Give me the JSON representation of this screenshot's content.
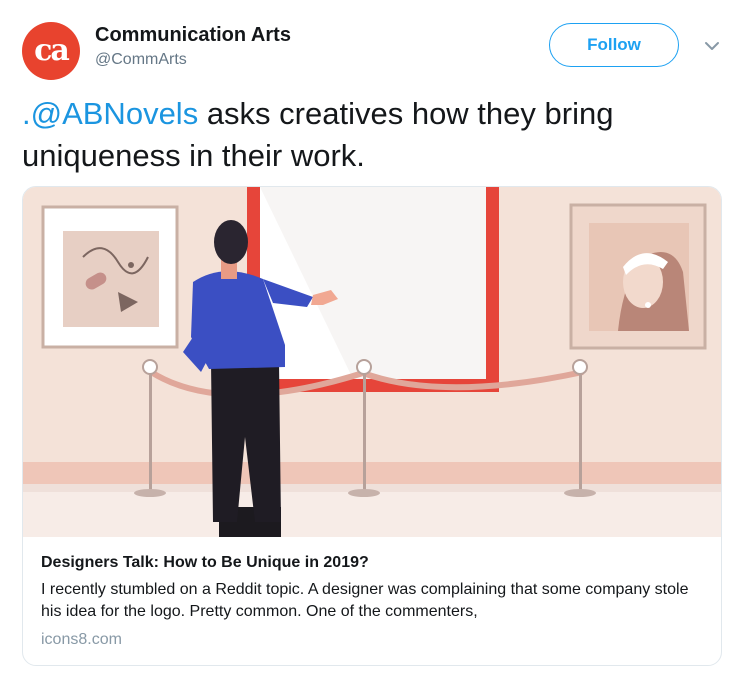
{
  "account": {
    "name": "Communication Arts",
    "handle": "@CommArts",
    "avatar_text": "ca"
  },
  "follow_label": "Follow",
  "tweet": {
    "mention": ".@ABNovels",
    "text": " asks creatives how they bring uniqueness in their work."
  },
  "card": {
    "title": "Designers Talk: How to Be Unique in 2019?",
    "description": "I recently stumbled on a Reddit topic. A designer was complaining that some company stole his idea for the logo. Pretty common. One of the commenters,",
    "domain": "icons8.com"
  },
  "colors": {
    "brand_red": "#e8432e",
    "link_blue": "#1b95e0",
    "follow_blue": "#1da1f2",
    "text": "#14171a",
    "muted": "#657786"
  },
  "icons": {
    "caret": "chevron-down-icon"
  }
}
